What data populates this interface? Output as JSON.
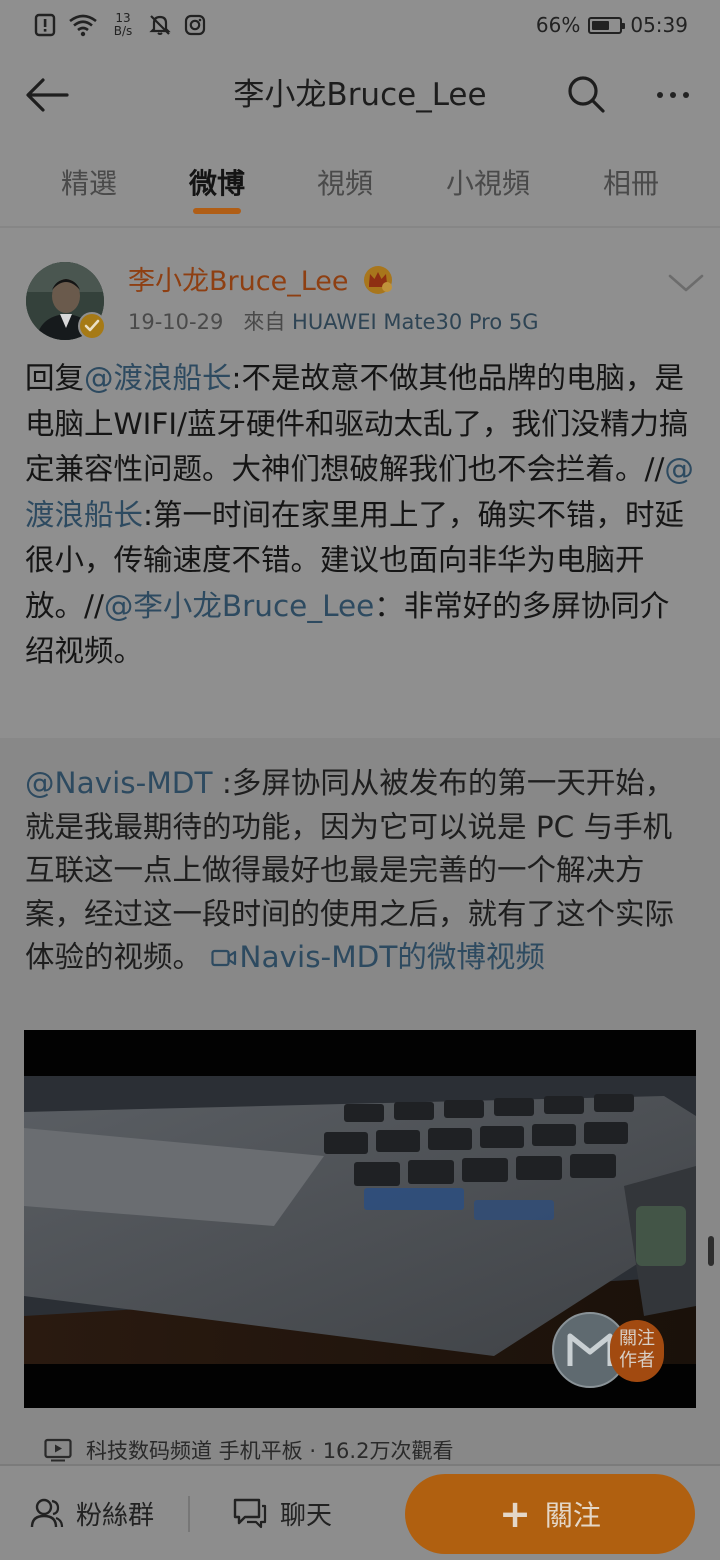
{
  "status_bar": {
    "net_speed_value": "13",
    "net_speed_unit": "B/s",
    "battery_percent": "66%",
    "battery_level": 0.66,
    "time": "05:39"
  },
  "header": {
    "title": "李小龙Bruce_Lee"
  },
  "tabs": [
    {
      "label": "精選"
    },
    {
      "label": "微博"
    },
    {
      "label": "視頻"
    },
    {
      "label": "小視頻"
    },
    {
      "label": "相冊"
    }
  ],
  "active_tab": "微博",
  "post": {
    "author": "李小龙Bruce_Lee",
    "date": "19-10-29",
    "source_prefix": "來自",
    "device": "HUAWEI Mate30 Pro 5G",
    "text": {
      "p1": "回复",
      "m1": "@渡浪船长",
      "p2": ":不是故意不做其他品牌的电脑，是电脑上WIFI/蓝牙硬件和驱动太乱了，我们没精力搞定兼容性问题。大神们想破解我们也不会拦着。//",
      "m2": "@渡浪船长",
      "p3": ":第一时间在家里用上了，确实不错，时延很小，传输速度不错。建议也面向非华为电脑开放。//",
      "m3": "@李小龙Bruce_Lee",
      "p4": "：非常好的多屏协同介绍视频。"
    },
    "quote": {
      "mention": "@Navis-MDT",
      "text": " :多屏协同从被发布的第一天开始，就是我最期待的功能，因为它可以说是 PC 与手机互联这一点上做得最好也最是完善的一个解决方案，经过这一段时间的使用之后，就有了这个实际体验的视频。 ",
      "video_link": "Navis-MDT的微博视频"
    },
    "video": {
      "follow_line1": "關注",
      "follow_line2": "作者"
    },
    "video_meta": "科技数码频道 手机平板 · 16.2万次觀看"
  },
  "bottom_bar": {
    "fans_label": "粉絲群",
    "chat_label": "聊天",
    "follow_label": "關注"
  },
  "colors": {
    "accent": "#b06010",
    "username": "#8e3f12",
    "link": "#2d4a60",
    "background": "#8f8f8f"
  },
  "icons": [
    "alert-icon",
    "wifi-icon",
    "mute-icon",
    "instagram-icon",
    "battery-icon",
    "back-arrow-icon",
    "search-icon",
    "more-icon",
    "verified-icon",
    "crown-icon",
    "chevron-down-icon",
    "video-camera-icon",
    "play-icon",
    "people-icon",
    "chat-icon",
    "plus-icon"
  ]
}
